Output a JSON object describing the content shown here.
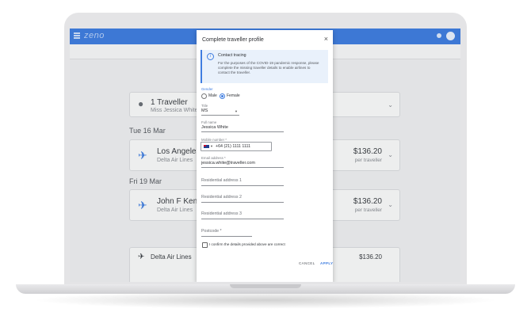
{
  "app": {
    "logo": "zeno"
  },
  "traveller_card": {
    "title": "1 Traveller",
    "subtitle": "Miss Jessica White"
  },
  "dates": [
    "Tue 16 Mar",
    "Fri 19 Mar"
  ],
  "flights": [
    {
      "route": "Los Angeles",
      "airline": "Delta Air Lines",
      "price": "$136.20",
      "per": "per traveller"
    },
    {
      "route": "John F Kenne",
      "airline": "Delta Air Lines",
      "price": "$136.20",
      "per": "per traveller"
    }
  ],
  "summary_rows": [
    {
      "airline": "Delta Air Lines",
      "price": "$136.20"
    }
  ],
  "dialog": {
    "title": "Complete traveller profile",
    "close": "×",
    "banner": {
      "title": "Contact tracing",
      "body": "For the purposes of the COVID-19 pandemic response, please complete the missing traveller details to enable airlines to contact the traveller."
    },
    "gender": {
      "label": "Gender",
      "options": [
        "Male",
        "Female"
      ],
      "selected": "Female"
    },
    "title_field": {
      "label": "Title",
      "value": "MS"
    },
    "full_name": {
      "label": "Full name",
      "value": "Jessica White"
    },
    "mobile": {
      "label": "Mobile number *",
      "value": "+64 (21) 1111 1111"
    },
    "email": {
      "label": "Email address *",
      "value": "jessica.white@traveller.com"
    },
    "address1": {
      "placeholder": "Residential address 1"
    },
    "address2": {
      "placeholder": "Residential address 2"
    },
    "address3": {
      "placeholder": "Residential address 3"
    },
    "postcode": {
      "placeholder": "Postcode *"
    },
    "confirm": "I confirm the details provided above are correct",
    "cancel": "CANCEL",
    "apply": "APPLY"
  }
}
